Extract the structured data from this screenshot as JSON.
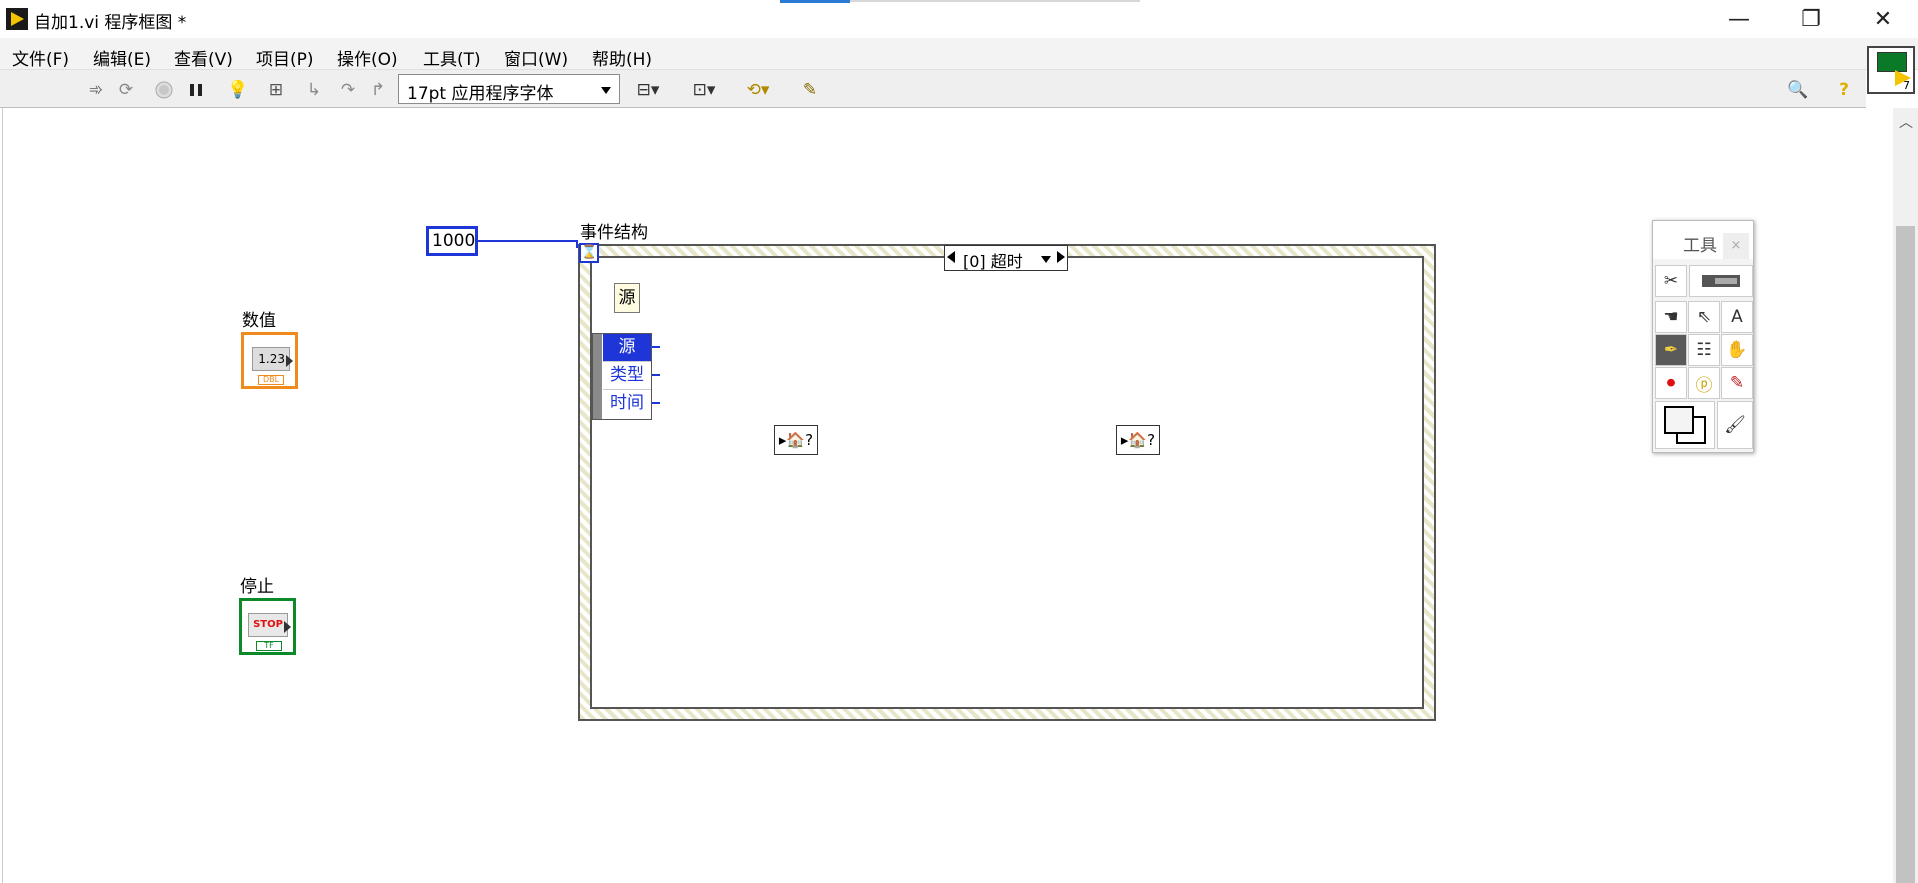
{
  "window": {
    "title": "自加1.vi 程序框图 *",
    "minimize_glyph": "—",
    "maximize_glyph": "❐",
    "close_glyph": "✕"
  },
  "menu": {
    "items": [
      "文件(F)",
      "编辑(E)",
      "查看(V)",
      "项目(P)",
      "操作(O)",
      "工具(T)",
      "窗口(W)",
      "帮助(H)"
    ]
  },
  "toolbar": {
    "font_select_value": "17pt 应用程序字体",
    "icons": [
      "run-arrow-icon",
      "run-continuously-icon",
      "abort-icon",
      "pause-icon",
      "highlight-execution-icon",
      "retain-wire-values-icon",
      "step-into-icon",
      "step-over-icon",
      "step-out-icon",
      "align-objects-icon",
      "distribute-objects-icon",
      "reorder-icon",
      "cleanup-diagram-icon",
      "search-icon",
      "help-icon"
    ],
    "vi_icon_number": "7"
  },
  "diagram": {
    "numeric_constant": "1000",
    "event_structure_label": "事件结构",
    "case_selector_text": "[0] 超时",
    "source_node": "源",
    "event_data": [
      "源",
      "类型",
      "时间"
    ],
    "unwired_terminal_text": "▸🏠?",
    "numeric_control_label": "数值",
    "numeric_control_display": "1.23",
    "numeric_control_type": "DBL",
    "stop_control_label": "停止",
    "stop_control_text": "STOP",
    "stop_control_type": "TF"
  },
  "tools_palette": {
    "title": "工具",
    "close": "×"
  },
  "colors": {
    "wire_blue": "#1e35d8",
    "numeric_orange": "#f08a1c",
    "boolean_green": "#0c8a2a"
  }
}
